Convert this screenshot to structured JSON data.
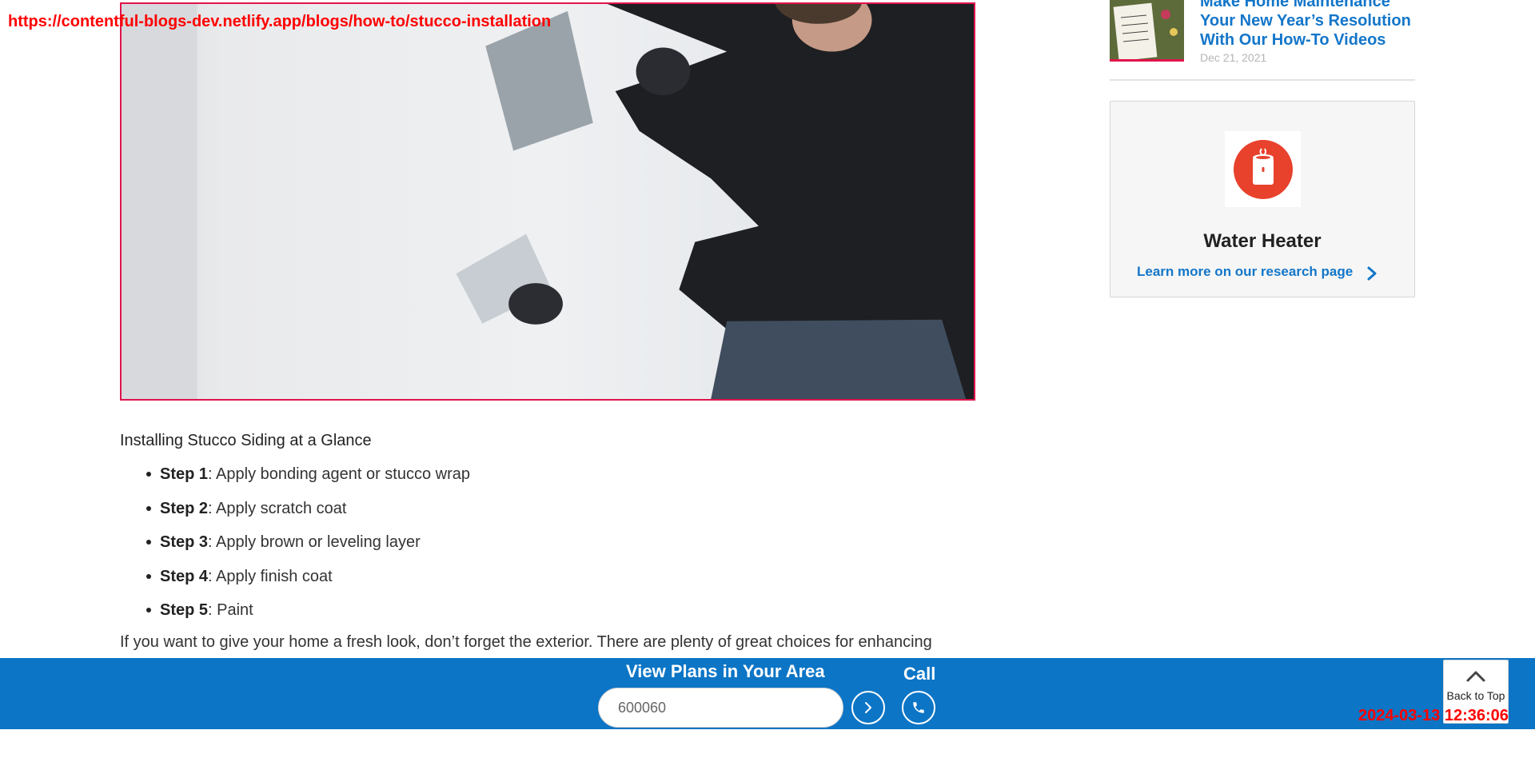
{
  "overlay": {
    "url": "https://contentful-blogs-dev.netlify.app/blogs/how-to/stucco-installation",
    "timestamp": "2024-03-13 12:36:06"
  },
  "article": {
    "glance_title": "Installing Stucco Siding at a Glance",
    "steps": [
      {
        "label": "Step 1",
        "text": ": Apply bonding agent or stucco wrap"
      },
      {
        "label": "Step 2",
        "text": ": Apply scratch coat"
      },
      {
        "label": "Step 3",
        "text": ": Apply brown or leveling layer"
      },
      {
        "label": "Step 4",
        "text": ": Apply finish coat"
      },
      {
        "label": "Step 5",
        "text": ": Paint"
      }
    ],
    "paragraph": "If you want to give your home a fresh look, don’t forget the exterior. There are plenty of great choices for enhancing"
  },
  "sidebar": {
    "related": {
      "title": "Make Home Maintenance Your New Year’s Resolution With Our How-To Videos",
      "date": "Dec 21, 2021"
    },
    "card": {
      "icon": "water-heater-icon",
      "title": "Water Heater",
      "link": "Learn more on our research page"
    }
  },
  "bottom_bar": {
    "view_plans_label": "View Plans in Your Area",
    "zip_value": "600060",
    "call_label": "Call",
    "back_to_top_label": "Back to Top"
  },
  "colors": {
    "brand_blue": "#0c75c6",
    "link_blue": "#1376c9",
    "accent_red": "#e0144c",
    "icon_red": "#e8412c"
  }
}
